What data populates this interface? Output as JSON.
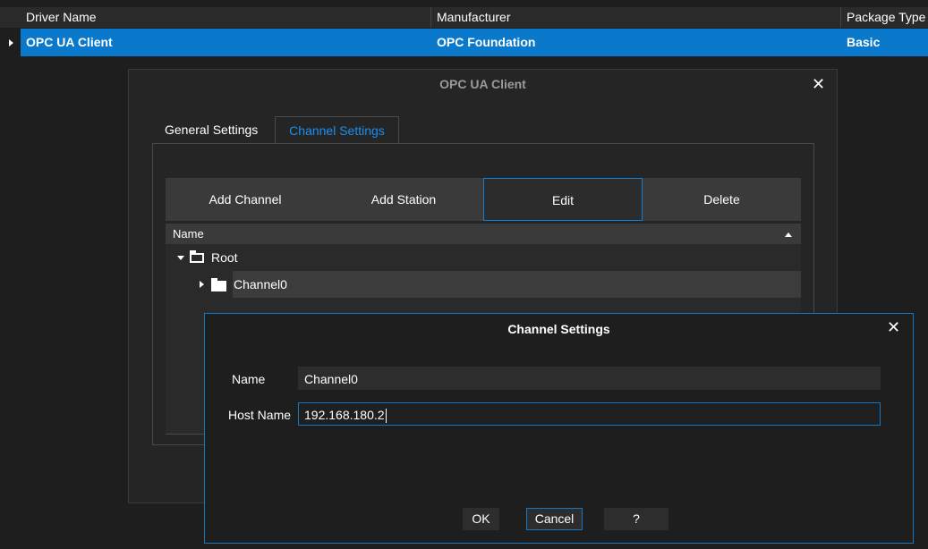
{
  "grid": {
    "columns": [
      "Driver Name",
      "Manufacturer",
      "Package Type"
    ],
    "row": {
      "driver_name": "OPC UA Client",
      "manufacturer": "OPC Foundation",
      "package_type": "Basic"
    }
  },
  "driver_dialog": {
    "title": "OPC UA Client",
    "close_glyph": "✕",
    "tabs": {
      "general": "General Settings",
      "channel": "Channel Settings"
    },
    "toolbar": {
      "add_channel": "Add Channel",
      "add_station": "Add Station",
      "edit": "Edit",
      "delete": "Delete"
    },
    "tree": {
      "header": "Name",
      "root": "Root",
      "channel": "Channel0"
    }
  },
  "channel_dialog": {
    "title": "Channel Settings",
    "close_glyph": "✕",
    "name_label": "Name",
    "name_value": "Channel0",
    "host_label": "Host Name",
    "host_value": "192.168.180.2",
    "ok_label": "OK",
    "cancel_label": "Cancel",
    "help_label": "?"
  },
  "colors": {
    "selection": "#0a79cc",
    "accent": "#1576c4",
    "active_tab": "#1a8ff0"
  }
}
